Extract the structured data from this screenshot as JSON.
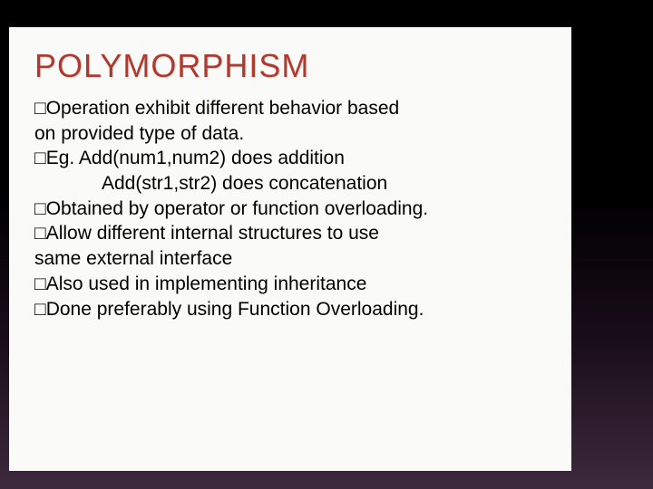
{
  "title": "POLYMORPHISM",
  "glyph": "□",
  "bullets": {
    "b1a": "Operation exhibit different behavior based",
    "b1b": "on provided type of data.",
    "b2a": "Eg. Add(num1,num2) does addition",
    "b2b": "Add(str1,str2) does concatenation",
    "b3": "Obtained by operator or function overloading.",
    "b4a": "Allow different internal structures to use",
    "b4b": "same external interface",
    "b5": "Also used in implementing inheritance",
    "b6": "Done preferably using Function Overloading."
  }
}
